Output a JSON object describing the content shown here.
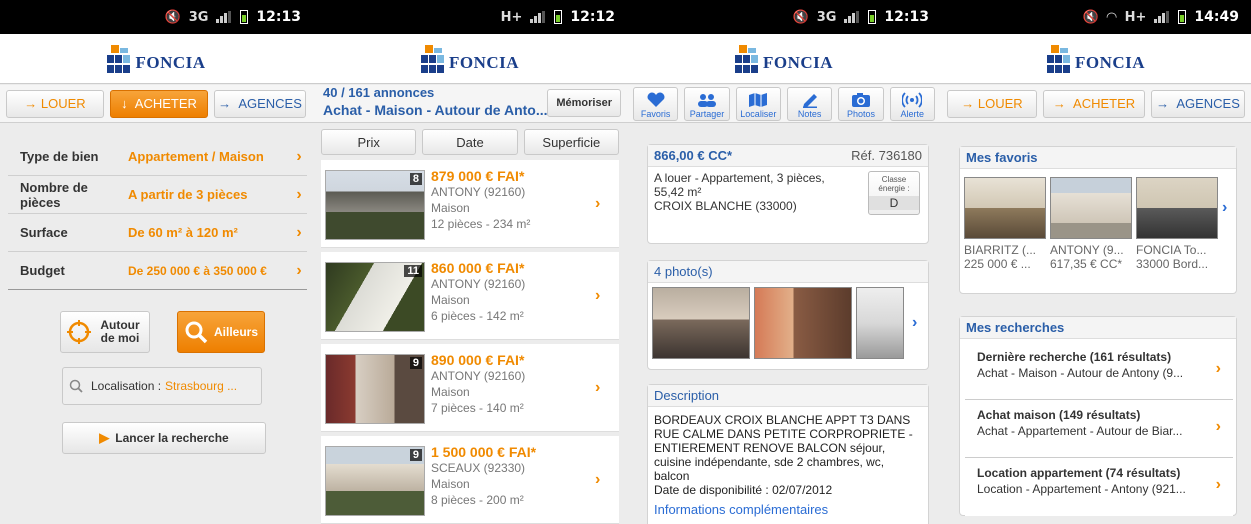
{
  "colors": {
    "brand_orange": "#f08a00",
    "brand_blue": "#1a3e8a",
    "link_blue": "#2a5ea8"
  },
  "logo_text": "FONCIA",
  "panel1": {
    "status_time": "12:13",
    "nav": {
      "louer": "LOUER",
      "acheter": "ACHETER",
      "agences": "AGENCES"
    },
    "criteria": [
      {
        "label": "Type de bien",
        "value": "Appartement / Maison"
      },
      {
        "label": "Nombre de pièces",
        "value": "A partir de 3 pièces"
      },
      {
        "label": "Surface",
        "value": "De 60 m² à 120 m²"
      },
      {
        "label": "Budget",
        "value": "De 250 000 € à 350 000 €"
      }
    ],
    "autour": "Autour de moi",
    "ailleurs": "Ailleurs",
    "localisation_label": "Localisation :",
    "localisation_value": "Strasbourg ...",
    "lancer": "Lancer la recherche"
  },
  "panel2": {
    "status_time": "12:12",
    "count": "40 / 161 annonces",
    "subtitle": "Achat - Maison - Autour de Anto...",
    "memoriser": "Mémoriser",
    "tabs": [
      "Prix",
      "Date",
      "Superficie"
    ],
    "listings": [
      {
        "n": "8",
        "price": "879 000 € FAI*",
        "city": "ANTONY (92160)",
        "type": "Maison",
        "details": "12 pièces - 234 m²"
      },
      {
        "n": "11",
        "price": "860 000 € FAI*",
        "city": "ANTONY (92160)",
        "type": "Maison",
        "details": "6 pièces - 142 m²"
      },
      {
        "n": "9",
        "price": "890 000 € FAI*",
        "city": "ANTONY (92160)",
        "type": "Maison",
        "details": "7 pièces - 140 m²"
      },
      {
        "n": "9",
        "price": "1 500 000 € FAI*",
        "city": "SCEAUX (92330)",
        "type": "Maison",
        "details": "8 pièces - 200 m²"
      }
    ]
  },
  "panel3": {
    "status_time": "12:13",
    "tools": [
      "Favoris",
      "Partager",
      "Localiser",
      "Notes",
      "Photos",
      "Alerte"
    ],
    "price": "866,00 € CC*",
    "ref": "Réf. 736180",
    "desc_line1": "A louer - Appartement, 3 pièces,",
    "desc_line2": "55,42 m²",
    "desc_line3": "CROIX BLANCHE (33000)",
    "classe_label": "Classe énergie :",
    "classe_value": "D",
    "photos_title": "4 photo(s)",
    "description_title": "Description",
    "description": "BORDEAUX CROIX BLANCHE APPT T3 DANS RUE CALME DANS PETITE CORPROPRIETE - ENTIEREMENT RENOVE BALCON   séjour, cuisine indépendante, sde 2 chambres, wc, balcon",
    "disponibilite": "Date de disponibilité : 02/07/2012",
    "info_link": "Informations complémentaires"
  },
  "panel4": {
    "status_time": "14:49",
    "nav": {
      "louer": "LOUER",
      "acheter": "ACHETER",
      "agences": "AGENCES"
    },
    "favoris_title": "Mes favoris",
    "favoris": [
      {
        "city": "BIARRITZ (...",
        "price": "225 000 € ..."
      },
      {
        "city": "ANTONY (9...",
        "price": "617,35 € CC*"
      },
      {
        "city": "FONCIA To...",
        "price": "33000 Bord..."
      }
    ],
    "recherches_title": "Mes recherches",
    "recherches": [
      {
        "title": "Dernière recherche (161 résultats)",
        "sub": "Achat - Maison - Autour de Antony (9..."
      },
      {
        "title": "Achat maison (149 résultats)",
        "sub": "Achat - Appartement - Autour de Biar..."
      },
      {
        "title": "Location appartement (74 résultats)",
        "sub": "Location - Appartement - Antony (921..."
      }
    ]
  }
}
